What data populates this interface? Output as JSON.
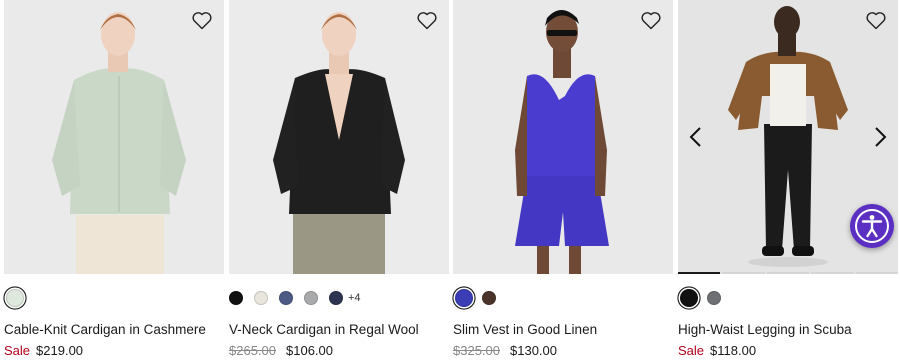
{
  "products": [
    {
      "name": "Cable-Knit Cardigan in Cashmere",
      "sale_label": "Sale",
      "price": "$219.00",
      "swatches": [
        {
          "color": "#dfe8dc",
          "selected": true
        }
      ]
    },
    {
      "name": "V-Neck Cardigan in Regal Wool",
      "original_price": "$265.00",
      "price": "$106.00",
      "swatches": [
        {
          "color": "#111111"
        },
        {
          "color": "#e9e6de"
        },
        {
          "color": "#4d5a86"
        },
        {
          "color": "#a9aaac"
        },
        {
          "color": "#2e3452"
        }
      ],
      "more_colors": "+4"
    },
    {
      "name": "Slim Vest in Good Linen",
      "original_price": "$325.00",
      "price": "$130.00",
      "swatches": [
        {
          "color": "#3a3db6",
          "selected": true
        },
        {
          "color": "#4a3429"
        }
      ]
    },
    {
      "name": "High-Waist Legging in Scuba",
      "sale_label": "Sale",
      "price": "$118.00",
      "swatches": [
        {
          "color": "#111111",
          "selected": true
        },
        {
          "color": "#6e7074"
        }
      ],
      "carousel_progress": 0.2
    }
  ],
  "icons": {
    "favorite": "heart-icon",
    "carousel_prev": "chevron-left-icon",
    "carousel_next": "chevron-right-icon",
    "accessibility": "accessibility-icon"
  },
  "colors": {
    "sale": "#b3001b",
    "accessibility_button": "#5a2fc2"
  }
}
